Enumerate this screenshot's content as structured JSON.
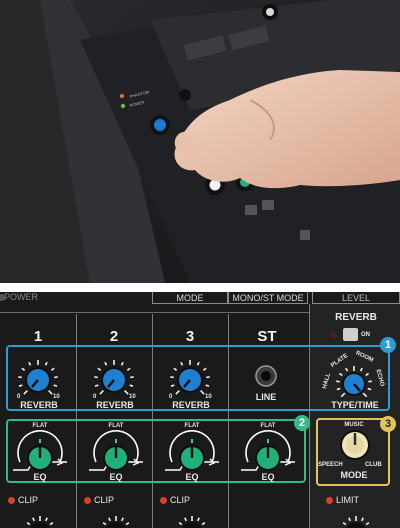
{
  "photo": {
    "description_tags": [
      "hand-adjusting-knob"
    ],
    "panel_texts": [
      "PHANTOM",
      "POWER"
    ]
  },
  "panel": {
    "header": {
      "power": "POWER",
      "mode": "MODE",
      "mono_st_mode": "MONO/ST MODE",
      "level": "LEVEL"
    },
    "channels": [
      {
        "number": "1",
        "reverb_label": "REVERB",
        "min": "0",
        "max": "10",
        "eq_label": "EQ",
        "flat": "FLAT",
        "clip": "CLIP"
      },
      {
        "number": "2",
        "reverb_label": "REVERB",
        "min": "0",
        "max": "10",
        "eq_label": "EQ",
        "flat": "FLAT",
        "clip": "CLIP"
      },
      {
        "number": "3",
        "reverb_label": "REVERB",
        "min": "0",
        "max": "10",
        "eq_label": "EQ",
        "flat": "FLAT",
        "clip": "CLIP"
      }
    ],
    "st": {
      "number": "ST",
      "line_label": "LINE"
    },
    "reverb_section": {
      "title": "REVERB",
      "on_label": "ON",
      "type_time_label": "TYPE/TIME",
      "positions": [
        "HALL",
        "PLATE",
        "ROOM",
        "ECHO"
      ]
    },
    "mode_section": {
      "music": "MUSIC",
      "speech": "SPEECH",
      "club": "CLUB",
      "mode_label": "MODE"
    },
    "limit_label": "LIMIT",
    "badges": [
      "1",
      "2",
      "3"
    ],
    "colors": {
      "knob_blue": "#1f7fd0",
      "knob_green": "#1fb07b",
      "knob_cream": "#efe5b8",
      "highlight_blue": "#2f9bd7",
      "highlight_green": "#35b987",
      "highlight_yellow": "#e4c45d",
      "clip_led": "#d8402a"
    }
  }
}
